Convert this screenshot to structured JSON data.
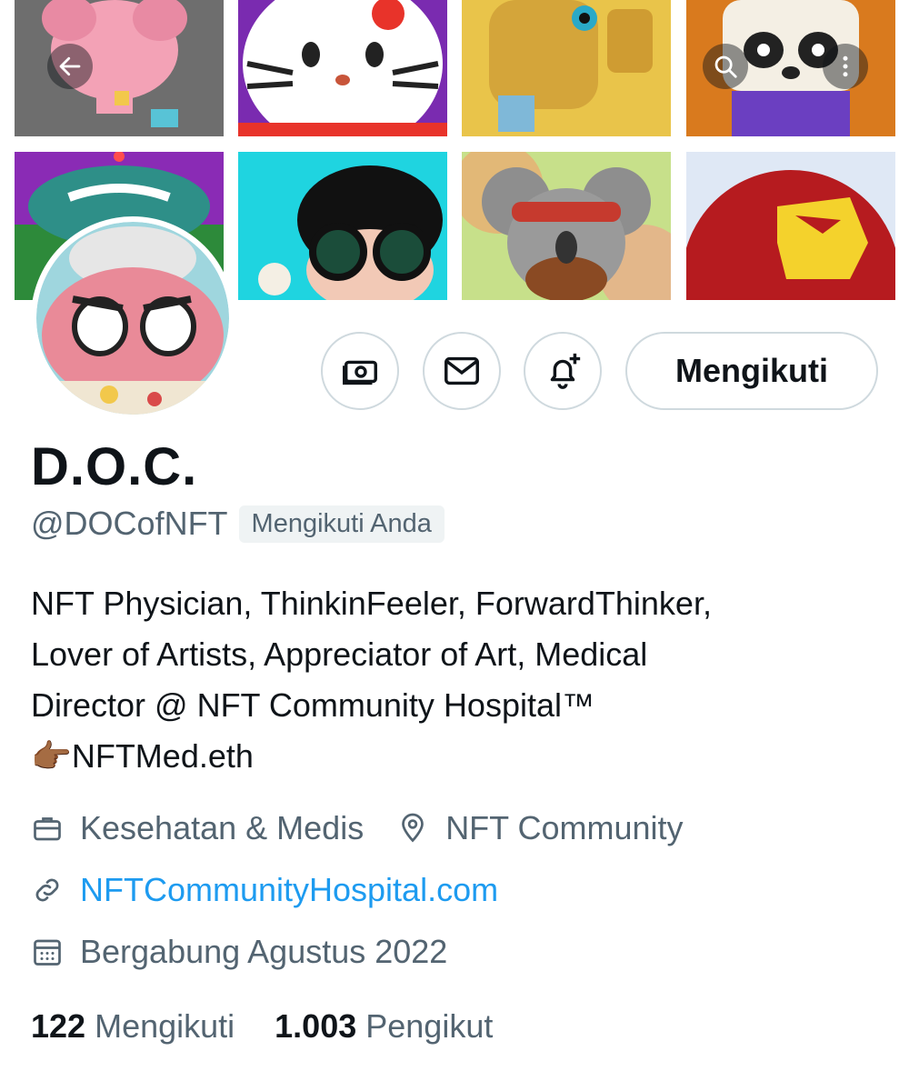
{
  "nav": {
    "back_icon": "arrow-left-icon",
    "search_icon": "search-icon",
    "more_icon": "more-vertical-icon"
  },
  "banner": {
    "tiles": [
      "pink-elephant-nft",
      "white-cat-nft",
      "gold-robot-nft",
      "panda-nft",
      "punk-cap-nft",
      "sunglasses-curly-hair-nft",
      "koala-bandana-nft",
      "red-gold-iron-helmet-nft"
    ]
  },
  "actions": {
    "tip_icon": "money-icon",
    "message_icon": "mail-icon",
    "notify_icon": "bell-plus-icon",
    "follow_label": "Mengikuti"
  },
  "profile": {
    "name": "D.O.C.",
    "handle": "@DOCofNFT",
    "follows_you": "Mengikuti Anda",
    "bio_lines": [
      "NFT Physician, ThinkinFeeler, ForwardThinker,",
      "Lover of Artists, Appreciator of Art, Medical",
      "Director @ NFT Community Hospital™",
      "👉🏾NFTMed.eth"
    ],
    "category": "Kesehatan & Medis",
    "location": "NFT Community",
    "website": "NFTCommunityHospital.com",
    "joined": "Bergabung Agustus 2022"
  },
  "stats": {
    "following_count": "122",
    "following_label": "Mengikuti",
    "followers_count": "1.003",
    "followers_label": "Pengikut"
  },
  "colors": {
    "accent": "#1d9bf0",
    "secondary_text": "#536471",
    "border": "#cfd9de"
  }
}
